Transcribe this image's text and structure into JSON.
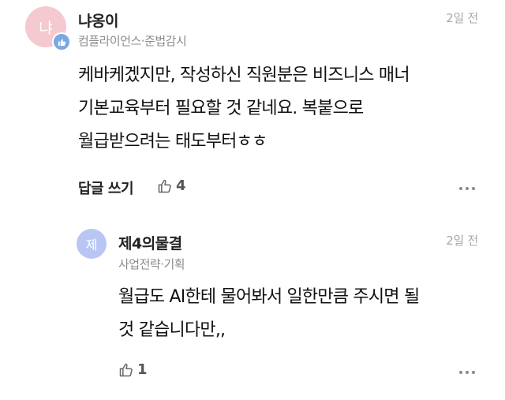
{
  "comment": {
    "avatar_text": "냐",
    "author": "냐옹이",
    "affiliation": "컴플라이언스·준법감시",
    "time": "2일 전",
    "body_lines": [
      "케바케겠지만, 작성하신 직원분은 비즈니스 매너",
      "기본교육부터 필요할 것 같네요. 복붙으로",
      "월급받으려는 태도부터ㅎㅎ"
    ],
    "reply_label": "답글 쓰기",
    "likes": "4",
    "icons": {
      "badge": "thumbs-up-badge-icon",
      "like": "thumbs-up-icon",
      "more": "more-icon"
    }
  },
  "reply": {
    "avatar_text": "제",
    "author": "제4의물결",
    "affiliation": "사업전략·기획",
    "time": "2일 전",
    "body_lines": [
      "월급도 AI한테 물어봐서 일한만큼 주시면 될",
      "것 같습니다만,,"
    ],
    "likes": "1",
    "icons": {
      "like": "thumbs-up-icon",
      "more": "more-icon"
    }
  },
  "colors": {
    "main_avatar": "#f4c9cf",
    "reply_avatar": "#b9c6f4",
    "badge": "#7aa8e4",
    "muted_text": "#8b8b8b"
  }
}
